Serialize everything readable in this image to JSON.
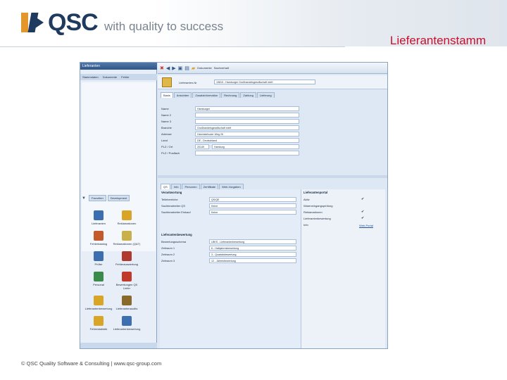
{
  "slide": {
    "brand": "QSC",
    "tagline": "with quality to success",
    "title": "Lieferantenstamm",
    "footer": "© QSC Quality Software & Consulting | www.qsc-group.com"
  },
  "app": {
    "window_title": "Lieferanten",
    "menu": [
      "Stammdaten",
      "Dokumente",
      "Fehler"
    ],
    "toolbar": {
      "labels": [
        "Dokumente",
        "Sachverhalt"
      ]
    },
    "header": {
      "label": "Lieferanten-Nr",
      "value": "19819 - Hamburger Großhandelsgesellschaft mbH"
    },
    "tabs_top": [
      "Basis",
      "Ansichten",
      "Zusatzinformation",
      "Rechnung",
      "Zahlung",
      "Lieferung"
    ],
    "form": [
      {
        "label": "Name",
        "value": "Hamburger"
      },
      {
        "label": "Name 2",
        "value": ""
      },
      {
        "label": "Name 3",
        "value": ""
      },
      {
        "label": "Branche",
        "value": "Großhandelsgesellschaft mbH"
      },
      {
        "label": "Adresse",
        "value": "Harvestehuder Weg 26"
      },
      {
        "label": "Land",
        "value": "DE - Deutschland"
      },
      {
        "label": "PLZ / Ort",
        "value": "20149",
        "city": "Hamburg"
      },
      {
        "label": "PLZ / Postfach",
        "value": ""
      }
    ],
    "tabs_bottom": [
      "QS",
      "Info",
      "Personen",
      "Zertifikate",
      "Web-Vorgaben"
    ],
    "left_tabs": [
      "Favoriten",
      "Development"
    ],
    "left_icons": [
      {
        "name": "doc-icon",
        "label": "Lieferanten",
        "color": "#3b6fb0"
      },
      {
        "name": "gear-icon",
        "label": "Reklamationen",
        "color": "#d9a527"
      },
      {
        "name": "notes-icon",
        "label": "Fehlerkatalog",
        "color": "#c45a2c"
      },
      {
        "name": "pen-icon",
        "label": "Reklamationen (Q&T)",
        "color": "#c9b04a"
      },
      {
        "name": "star-icon",
        "label": "Prüfer",
        "color": "#3b6fb0"
      },
      {
        "name": "error-icon",
        "label": "Fehlerauswertung",
        "color": "#b03a2e"
      },
      {
        "name": "person-icon",
        "label": "Personal",
        "color": "#3a8a4a"
      },
      {
        "name": "rating-icon",
        "label": "Bewertungen QS Liefer",
        "color": "#c0392b"
      },
      {
        "name": "alert-icon",
        "label": "Lieferantenbewertung",
        "color": "#d9a527"
      },
      {
        "name": "tree-icon",
        "label": "Lieferantenaudits",
        "color": "#8a6a2c"
      },
      {
        "name": "lock-icon",
        "label": "Fehlerstatistik",
        "color": "#d9a527"
      },
      {
        "name": "truck-icon",
        "label": "Lieferantenbewertung",
        "color": "#3b6fb0"
      }
    ],
    "qs": {
      "section1": "Verantwortung",
      "rows": [
        {
          "label": "Teilebereiche",
          "value": "QS/QE"
        },
        {
          "label": "Sachbearbeiter QS",
          "value": "Keine"
        },
        {
          "label": "Sachbearbeiter Einkauf",
          "value": "Keine"
        }
      ],
      "section2": "Lieferantenbewertung",
      "rows2": [
        {
          "label": "Bewertungsschema",
          "value": "LBKS - Lieferantenbewertung"
        },
        {
          "label": "Zeitraum 1",
          "value": "6 - Halbjahresbewertung"
        },
        {
          "label": "Zeitraum 2",
          "value": "3 - Quartalsbewertung"
        },
        {
          "label": "Zeitraum 3",
          "value": "12 - Jahresbewertung"
        }
      ],
      "right_section": "Lieferantenportal",
      "right_rows": [
        {
          "label": "Aktiv",
          "check": "✔"
        },
        {
          "label": "Wareneingangsprüfung",
          "check": ""
        },
        {
          "label": "Reklamationen",
          "check": "✔"
        },
        {
          "label": "Lieferantenbewertung",
          "check": "✔"
        },
        {
          "label": "Info",
          "check": ""
        }
      ],
      "web_link": "Web-Portal"
    }
  }
}
